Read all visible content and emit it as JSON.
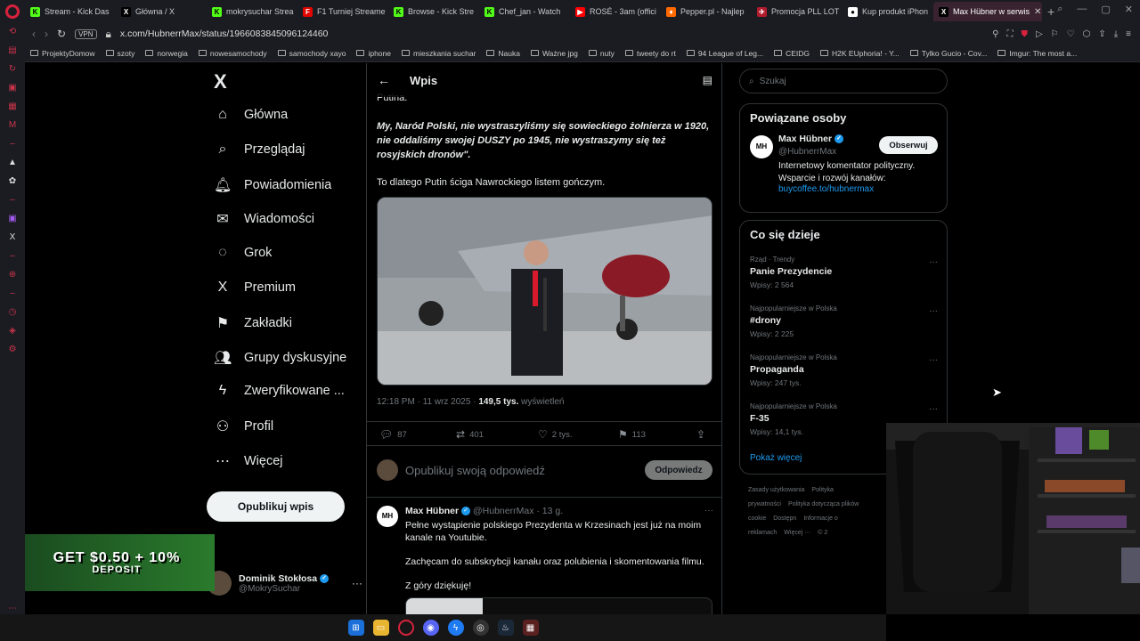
{
  "browser": {
    "tabs": [
      {
        "label": "Stream - Kick Das",
        "color": "#53fc18",
        "glyph": "K"
      },
      {
        "label": "Główna / X",
        "color": "#000000",
        "glyph": "X"
      },
      {
        "label": "mokrysuchar Strea",
        "color": "#53fc18",
        "glyph": "K"
      },
      {
        "label": "F1 Turniej Streame",
        "color": "#e10600",
        "glyph": "F"
      },
      {
        "label": "Browse - Kick Stre",
        "color": "#53fc18",
        "glyph": "K"
      },
      {
        "label": "Chef_jan - Watch",
        "color": "#53fc18",
        "glyph": "K"
      },
      {
        "label": "ROSÉ - 3am (offici",
        "color": "#ff0000",
        "glyph": "▶"
      },
      {
        "label": "Pepper.pl - Najlep",
        "color": "#ff6a00",
        "glyph": "♦"
      },
      {
        "label": "Promocja PLL LOT",
        "color": "#b01c2e",
        "glyph": "✈"
      },
      {
        "label": "Kup produkt iPhon",
        "color": "#ffffff",
        "glyph": "●"
      }
    ],
    "active_tab": {
      "label": "Max Hübner w serwis",
      "close": "✕"
    },
    "new_tab": "+",
    "url": "x.com/HubnerrMax/status/1966083845096124460",
    "vpn": "VPN",
    "bookmarks": [
      "ProjektyDomow",
      "szoty",
      "norwegia",
      "nowesamochody",
      "samochody xayo",
      "iphone",
      "mieszkania suchar",
      "Nauka",
      "Ważne jpg",
      "nuty",
      "tweety do rt",
      "94 League of Leg...",
      "CEIDG",
      "H2K EUphoria! - Y...",
      "Tylko Gucio - Cov...",
      "Imgur: The most a..."
    ]
  },
  "nav": {
    "logo": "X",
    "items": [
      {
        "label": "Główna",
        "icon": "⌂"
      },
      {
        "label": "Przeglądaj",
        "icon": "⌕"
      },
      {
        "label": "Powiadomienia",
        "icon": "🔔︎"
      },
      {
        "label": "Wiadomości",
        "icon": "✉"
      },
      {
        "label": "Grok",
        "icon": "◌"
      },
      {
        "label": "Premium",
        "icon": "X"
      },
      {
        "label": "Zakładki",
        "icon": "⚑"
      },
      {
        "label": "Grupy dyskusyjne",
        "icon": "👥︎"
      },
      {
        "label": "Zweryfikowane ...",
        "icon": "ϟ"
      },
      {
        "label": "Profil",
        "icon": "⚇"
      },
      {
        "label": "Więcej",
        "icon": "⋯"
      }
    ],
    "post_button": "Opublikuj wpis",
    "account": {
      "name": "Dominik Stokłosa",
      "handle": "@MokrySuchar",
      "more": "···"
    }
  },
  "ad": {
    "line1": "GET $0.50 + 10%",
    "line2": "DEPOSIT"
  },
  "main": {
    "header_title": "Wpis",
    "back": "←",
    "prev_line": "Putina.",
    "quote": "My, Naród Polski, nie wystraszyliśmy się sowieckiego żołnierza w 1920, nie oddaliśmy swojej DUSZY po 1945, nie wystraszymy się też rosyjskich dronów\".",
    "line2": "To dlatego Putin ściga Nawrockiego listem gończym.",
    "meta_time": "12:18 PM · 11 wrz 2025 · ",
    "meta_views": "149,5 tys.",
    "meta_views_label": " wyświetleń",
    "actions": {
      "replies": "87",
      "reposts": "401",
      "likes": "2 tys.",
      "bookmarks": "113"
    },
    "reply_placeholder": "Opublikuj swoją odpowiedź",
    "reply_button": "Odpowiedz",
    "reply_tweet": {
      "avatar": "MH",
      "name": "Max Hübner",
      "handle": "@HubnerrMax · 13 g.",
      "p1": "Pełne wystąpienie polskiego Prezydenta w Krzesinach jest już na moim kanale na Youtubie.",
      "p2": "Zachęcam do subskrybcji kanału oraz polubienia i skomentowania filmu.",
      "p3": "Z góry dziękuję!"
    }
  },
  "right": {
    "search_placeholder": "Szukaj",
    "related_title": "Powiązane osoby",
    "person": {
      "avatar": "MH",
      "name": "Max Hübner",
      "handle": "@HubnerrMax",
      "follow": "Obserwuj",
      "bio": "Internetowy komentator polityczny. Wsparcie i rozwój kanałów:",
      "link": "buycoffee.to/hubnermax"
    },
    "trends_title": "Co się dzieje",
    "trends": [
      {
        "category": "Rząd · Trendy",
        "title": "Panie Prezydencie",
        "count": "Wpisy: 2 564"
      },
      {
        "category": "Najpopularniejsze w Polska",
        "title": "#drony",
        "count": "Wpisy: 2 225"
      },
      {
        "category": "Najpopularniejsze w Polska",
        "title": "Propaganda",
        "count": "Wpisy: 247 tys."
      },
      {
        "category": "Najpopularniejsze w Polska",
        "title": "F-35",
        "count": "Wpisy: 14,1 tys."
      }
    ],
    "show_more": "Pokaż więcej",
    "footer": [
      "Zasady użytkowania",
      "Polityka prywatności",
      "Polityka dotycząca plików cookie",
      "Dostępn",
      "Informacje o reklamach",
      "Więcej ···",
      "© 2"
    ]
  }
}
